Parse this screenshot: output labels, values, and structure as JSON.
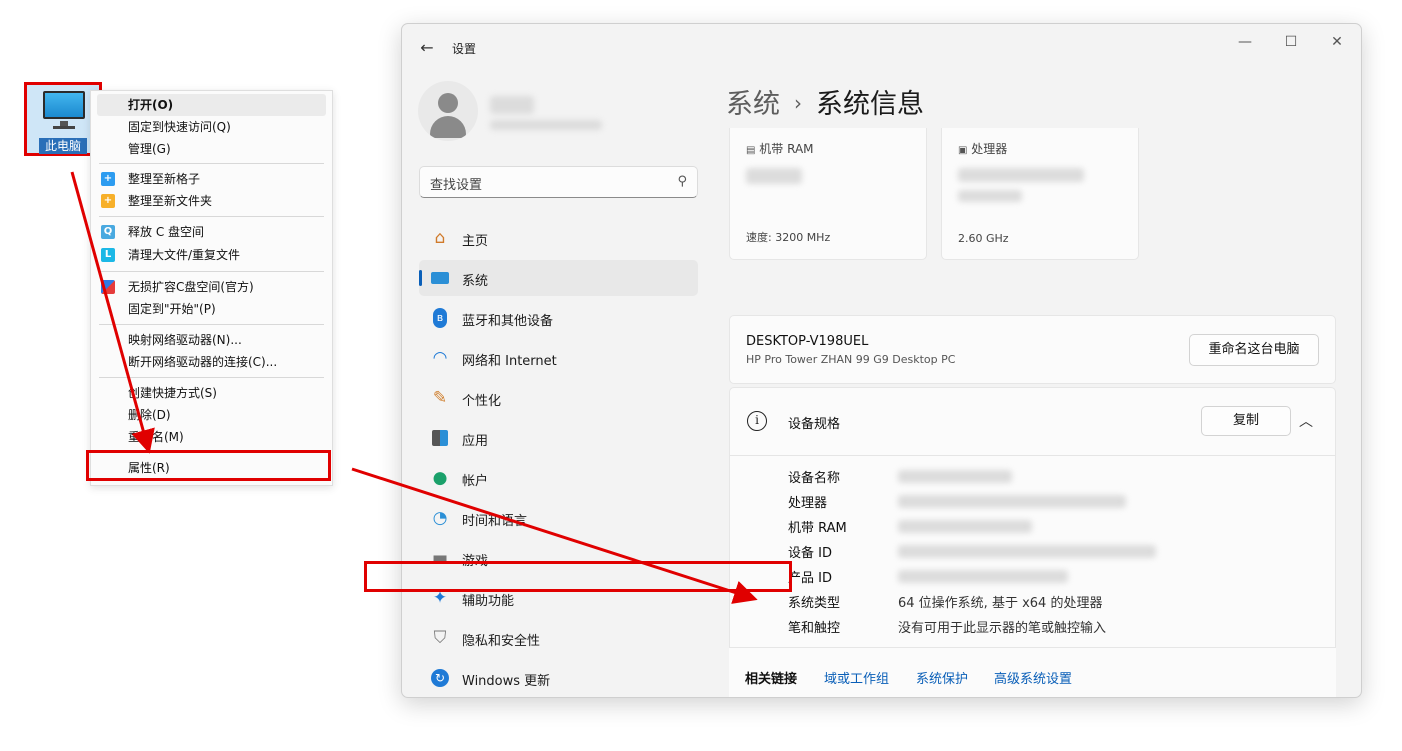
{
  "desktop": {
    "icon_label": "此电脑"
  },
  "context_menu": {
    "items": [
      {
        "label": "打开(O)"
      },
      {
        "label": "固定到快速访问(Q)"
      },
      {
        "label": "管理(G)"
      },
      {
        "label": "整理至新格子"
      },
      {
        "label": "整理至新文件夹"
      },
      {
        "label": "释放 C 盘空间"
      },
      {
        "label": "清理大文件/重复文件"
      },
      {
        "label": "无损扩容C盘空间(官方)"
      },
      {
        "label": "固定到\"开始\"(P)"
      },
      {
        "label": "映射网络驱动器(N)..."
      },
      {
        "label": "断开网络驱动器的连接(C)..."
      },
      {
        "label": "创建快捷方式(S)"
      },
      {
        "label": "删除(D)"
      },
      {
        "label": "重命名(M)"
      },
      {
        "label": "属性(R)"
      }
    ]
  },
  "window": {
    "title": "设置",
    "controls": {
      "minimize": "—",
      "maximize": "☐",
      "close": "✕"
    },
    "search_placeholder": "查找设置",
    "nav": [
      {
        "label": "主页",
        "icon": "home-icon"
      },
      {
        "label": "系统",
        "icon": "system-icon"
      },
      {
        "label": "蓝牙和其他设备",
        "icon": "bluetooth-icon"
      },
      {
        "label": "网络和 Internet",
        "icon": "wifi-icon"
      },
      {
        "label": "个性化",
        "icon": "brush-icon"
      },
      {
        "label": "应用",
        "icon": "apps-icon"
      },
      {
        "label": "帐户",
        "icon": "account-icon"
      },
      {
        "label": "时间和语言",
        "icon": "clock-globe-icon"
      },
      {
        "label": "游戏",
        "icon": "gamepad-icon"
      },
      {
        "label": "辅助功能",
        "icon": "accessibility-icon"
      },
      {
        "label": "隐私和安全性",
        "icon": "shield-icon"
      },
      {
        "label": "Windows 更新",
        "icon": "update-icon"
      }
    ],
    "breadcrumb": {
      "parent": "系统",
      "sep": "›",
      "current": "系统信息"
    },
    "cards": {
      "ram": {
        "label": "机带 RAM",
        "sub": "速度: 3200 MHz"
      },
      "cpu": {
        "label": "处理器",
        "sub": "2.60 GHz"
      }
    },
    "device": {
      "name": "DESKTOP-V198UEL",
      "model": "HP Pro Tower ZHAN 99 G9 Desktop PC",
      "rename_button": "重命名这台电脑"
    },
    "specs": {
      "title": "设备规格",
      "copy_button": "复制",
      "rows": [
        {
          "key": "设备名称",
          "value": ""
        },
        {
          "key": "处理器",
          "value": ""
        },
        {
          "key": "机带 RAM",
          "value": ""
        },
        {
          "key": "设备 ID",
          "value": ""
        },
        {
          "key": "产品 ID",
          "value": ""
        },
        {
          "key": "系统类型",
          "value": "64 位操作系统, 基于 x64 的处理器"
        },
        {
          "key": "笔和触控",
          "value": "没有可用于此显示器的笔或触控输入"
        }
      ]
    },
    "related_links": {
      "label": "相关链接",
      "links": [
        "域或工作组",
        "系统保护",
        "高级系统设置"
      ]
    }
  },
  "colors": {
    "highlight_red": "#e00000",
    "accent_blue": "#0a5fb8"
  }
}
